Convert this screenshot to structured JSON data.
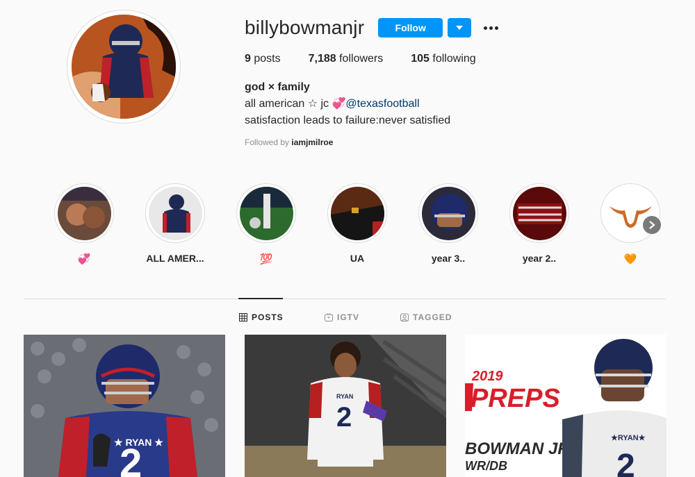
{
  "profile": {
    "username": "billybowmanjr",
    "follow_label": "Follow",
    "stats": [
      {
        "value": "9",
        "label": "posts"
      },
      {
        "value": "7,188",
        "label": "followers"
      },
      {
        "value": "105",
        "label": "following"
      }
    ],
    "bio": {
      "name": "god × family",
      "line1_prefix": "all american ☆ jc 💞",
      "line1_mention": "@texasfootball",
      "line2": "satisfaction leads to failure:never satisfied"
    },
    "followed_by_prefix": "Followed by",
    "followed_by_user": "iamjmilroe"
  },
  "highlights": [
    {
      "label": "💞"
    },
    {
      "label": "ALL AMER..."
    },
    {
      "label": "💯"
    },
    {
      "label": "UA"
    },
    {
      "label": "year 3.."
    },
    {
      "label": "year 2.."
    },
    {
      "label": "🧡"
    }
  ],
  "tabs": [
    {
      "label": "POSTS",
      "icon": "grid-icon",
      "active": true
    },
    {
      "label": "IGTV",
      "icon": "igtv-icon",
      "active": false
    },
    {
      "label": "TAGGED",
      "icon": "tagged-icon",
      "active": false
    }
  ],
  "posts": [
    {
      "graphic_text": [
        "★ RYAN ★",
        "2"
      ]
    },
    {
      "graphic_text": [
        "RYAN",
        "2"
      ]
    },
    {
      "graphic_text": [
        "2019",
        "PREPS",
        "BOWMAN JR.",
        "WR/DB",
        "★RYAN★",
        "2"
      ]
    }
  ],
  "colors": {
    "accent": "#0095f6",
    "mention": "#00376b",
    "muted": "#8e8e8e",
    "background": "#fafafa"
  }
}
